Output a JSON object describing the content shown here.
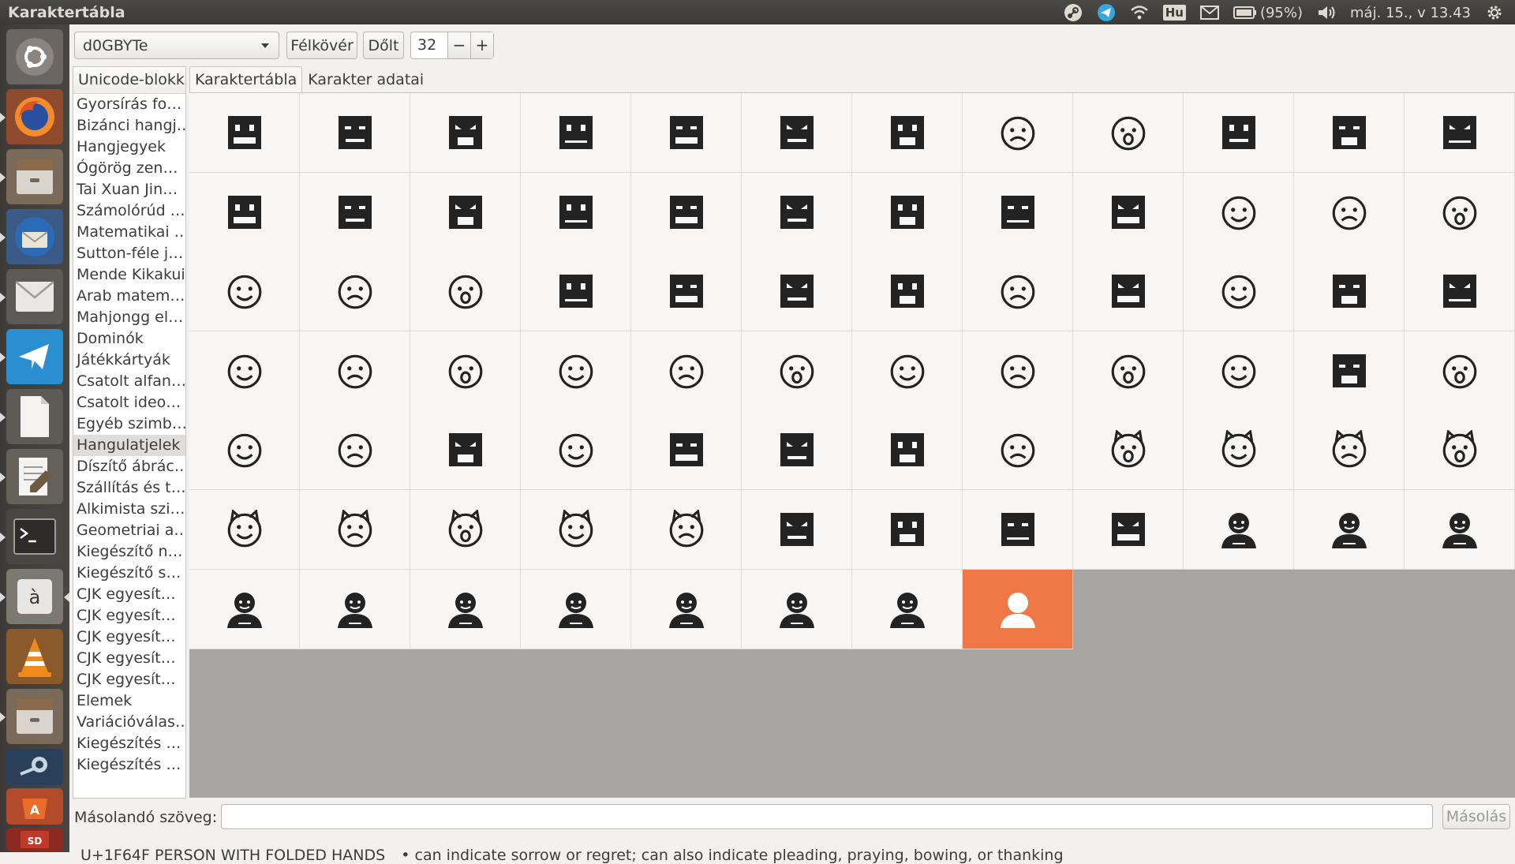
{
  "window": {
    "title": "Karaktertábla"
  },
  "panel": {
    "battery": "(95%)",
    "keyboard": "Hu",
    "clock": "máj. 15., v 13.43",
    "icons": [
      "steam-icon",
      "telegram-icon",
      "wifi-icon",
      "keyboard-layout-icon",
      "mail-icon",
      "battery-icon",
      "volume-icon",
      "settings-gear-icon"
    ]
  },
  "launcher": {
    "items": [
      "ubuntu-dash",
      "firefox",
      "files",
      "thunderbird",
      "mail",
      "telegram",
      "text-document",
      "text-editor",
      "terminal",
      "character-map",
      "vlc",
      "files-2",
      "steam",
      "software-center"
    ]
  },
  "toolbar": {
    "font_name": "d0GBYTe",
    "bold_label": "Félkövér",
    "italic_label": "Dőlt",
    "size_value": "32",
    "minus_label": "−",
    "plus_label": "+"
  },
  "sidebar": {
    "header": "Unicode-blokk",
    "selected_index": 17,
    "items": [
      "Gyorsírás fo…",
      "Bizánci hangj…",
      "Hangjegyek",
      "Ógörög zen…",
      "Tai Xuan Jin…",
      "Számolórúd …",
      "Matematikai …",
      "Sutton-féle j…",
      "Mende Kikakui",
      "Arab matem…",
      "Mahjongg el…",
      "Dominók",
      "Játékkártyák",
      "Csatolt alfan…",
      "Csatolt ideo…",
      "Egyéb szimb…",
      "Hangulatjelek",
      "Díszítő ábrác…",
      "Szállítás és t…",
      "Alkimista szi…",
      "Geometriai a…",
      "Kiegészítő n…",
      "Kiegészítő s…",
      "CJK egyesít…",
      "CJK egyesít…",
      "CJK egyesít…",
      "CJK egyesít…",
      "CJK egyesít…",
      "Elemek",
      "Variációválas…",
      "Kiegészítés …",
      "Kiegészítés …"
    ]
  },
  "tabs": [
    {
      "label": "Karaktertábla",
      "active": true
    },
    {
      "label": "Karakter adatai",
      "active": false
    }
  ],
  "grid": {
    "selected_index": 79,
    "cells": [
      {
        "style": "pixel",
        "icon": "pixel-face-grin-icon"
      },
      {
        "style": "pixel",
        "icon": "pixel-face-grin-squint-icon"
      },
      {
        "style": "pixel",
        "icon": "pixel-face-tears-joy-icon"
      },
      {
        "style": "pixel",
        "icon": "pixel-face-smile-open-icon"
      },
      {
        "style": "pixel",
        "icon": "pixel-face-smile-eyes-icon"
      },
      {
        "style": "pixel",
        "icon": "pixel-face-sweat-smile-icon"
      },
      {
        "style": "pixel",
        "icon": "pixel-face-laughing-icon"
      },
      {
        "style": "line",
        "icon": "smiling-face-halo-icon"
      },
      {
        "style": "line",
        "icon": "smiling-face-horns-icon"
      },
      {
        "style": "pixel",
        "icon": "pixel-face-wink-icon"
      },
      {
        "style": "pixel",
        "icon": "pixel-face-smile-closed-eyes-icon"
      },
      {
        "style": "pixel",
        "icon": "pixel-face-savoring-icon"
      },
      {
        "style": "pixel",
        "icon": "pixel-face-relieved-icon"
      },
      {
        "style": "pixel",
        "icon": "pixel-face-heart-eyes-icon"
      },
      {
        "style": "pixel",
        "icon": "pixel-face-sunglasses-icon"
      },
      {
        "style": "pixel",
        "icon": "pixel-face-smirk-icon"
      },
      {
        "style": "pixel",
        "icon": "pixel-face-neutral-icon"
      },
      {
        "style": "pixel",
        "icon": "pixel-face-expressionless-icon"
      },
      {
        "style": "pixel",
        "icon": "pixel-face-unamused-icon"
      },
      {
        "style": "pixel",
        "icon": "pixel-face-cold-sweat-icon"
      },
      {
        "style": "pixel",
        "icon": "pixel-face-pensive-icon"
      },
      {
        "style": "line",
        "icon": "confused-face-icon"
      },
      {
        "style": "line",
        "icon": "confounded-face-icon"
      },
      {
        "style": "line",
        "icon": "kissing-face-icon"
      },
      {
        "style": "line",
        "icon": "face-blowing-kiss-icon"
      },
      {
        "style": "line",
        "icon": "kissing-face-smiling-eyes-icon"
      },
      {
        "style": "line",
        "icon": "kissing-face-closed-eyes-icon"
      },
      {
        "style": "pixel",
        "icon": "pixel-face-tongue-icon"
      },
      {
        "style": "pixel",
        "icon": "pixel-face-tongue-wink-icon"
      },
      {
        "style": "pixel",
        "icon": "pixel-face-tongue-squint-icon"
      },
      {
        "style": "pixel",
        "icon": "pixel-face-disappointed-icon"
      },
      {
        "style": "line",
        "icon": "worried-face-icon"
      },
      {
        "style": "pixel",
        "icon": "pixel-face-angry-icon"
      },
      {
        "style": "line",
        "icon": "pouting-face-icon"
      },
      {
        "style": "pixel",
        "icon": "pixel-face-crying-icon"
      },
      {
        "style": "pixel",
        "icon": "pixel-face-persevering-icon"
      },
      {
        "style": "line",
        "icon": "face-steam-nose-icon"
      },
      {
        "style": "line",
        "icon": "disappointed-relieved-face-icon"
      },
      {
        "style": "line",
        "icon": "frowning-open-mouth-face-icon"
      },
      {
        "style": "line",
        "icon": "anguished-face-icon"
      },
      {
        "style": "line",
        "icon": "fearful-face-icon"
      },
      {
        "style": "line",
        "icon": "weary-face-icon"
      },
      {
        "style": "line",
        "icon": "sleepy-face-icon"
      },
      {
        "style": "line",
        "icon": "tired-face-icon"
      },
      {
        "style": "line",
        "icon": "grimacing-face-icon"
      },
      {
        "style": "line",
        "icon": "loudly-crying-face-icon"
      },
      {
        "style": "pixel",
        "icon": "pixel-face-open-mouth-icon"
      },
      {
        "style": "line",
        "icon": "hushed-face-icon"
      },
      {
        "style": "line",
        "icon": "face-screaming-fear-icon"
      },
      {
        "style": "line",
        "icon": "astonished-face-icon"
      },
      {
        "style": "pixel",
        "icon": "pixel-face-flushed-icon"
      },
      {
        "style": "line",
        "icon": "sleeping-face-icon"
      },
      {
        "style": "pixel",
        "icon": "pixel-face-sleeping-z-icon"
      },
      {
        "style": "pixel",
        "icon": "pixel-face-dizzy-icon"
      },
      {
        "style": "pixel",
        "icon": "pixel-face-no-mouth-icon"
      },
      {
        "style": "line",
        "icon": "face-medical-mask-icon"
      },
      {
        "style": "line",
        "icon": "grinning-cat-smiling-eyes-icon"
      },
      {
        "style": "line",
        "icon": "cat-tears-of-joy-icon"
      },
      {
        "style": "line",
        "icon": "smiling-cat-open-mouth-icon"
      },
      {
        "style": "line",
        "icon": "smiling-cat-heart-eyes-icon"
      },
      {
        "style": "line",
        "icon": "cat-wry-smile-icon"
      },
      {
        "style": "line",
        "icon": "kissing-cat-icon"
      },
      {
        "style": "line",
        "icon": "pouting-cat-icon"
      },
      {
        "style": "line",
        "icon": "crying-cat-icon"
      },
      {
        "style": "line",
        "icon": "weary-cat-icon"
      },
      {
        "style": "pixel",
        "icon": "pixel-face-slightly-frowning-icon"
      },
      {
        "style": "pixel",
        "icon": "pixel-face-slightly-smiling-icon"
      },
      {
        "style": "pixel",
        "icon": "pixel-face-upside-down-icon"
      },
      {
        "style": "pixel",
        "icon": "pixel-face-rolling-eyes-icon"
      },
      {
        "style": "line",
        "icon": "person-gesturing-no-icon"
      },
      {
        "style": "line",
        "icon": "person-gesturing-ok-icon"
      },
      {
        "style": "line",
        "icon": "person-bowing-icon"
      },
      {
        "style": "line",
        "icon": "see-no-evil-monkey-icon"
      },
      {
        "style": "line",
        "icon": "hear-no-evil-monkey-icon"
      },
      {
        "style": "line",
        "icon": "speak-no-evil-monkey-icon"
      },
      {
        "style": "line",
        "icon": "person-raising-hand-icon"
      },
      {
        "style": "line",
        "icon": "person-raising-both-hands-icon"
      },
      {
        "style": "line",
        "icon": "person-frowning-icon"
      },
      {
        "style": "line",
        "icon": "person-pouting-icon"
      },
      {
        "style": "line",
        "icon": "person-folded-hands-icon"
      }
    ]
  },
  "copy_row": {
    "label": "Másolandó szöveg:",
    "value": "",
    "button_label": "Másolás"
  },
  "status": {
    "codepoint_name": "U+1F64F PERSON WITH FOLDED HANDS",
    "note": "• can indicate sorrow or regret; can also indicate pleading, praying, bowing, or thanking"
  },
  "colors": {
    "selection": "#f07746",
    "panel": "#3c3b37",
    "launcher": "#45413e",
    "empty_grid": "#a7a5a2"
  }
}
